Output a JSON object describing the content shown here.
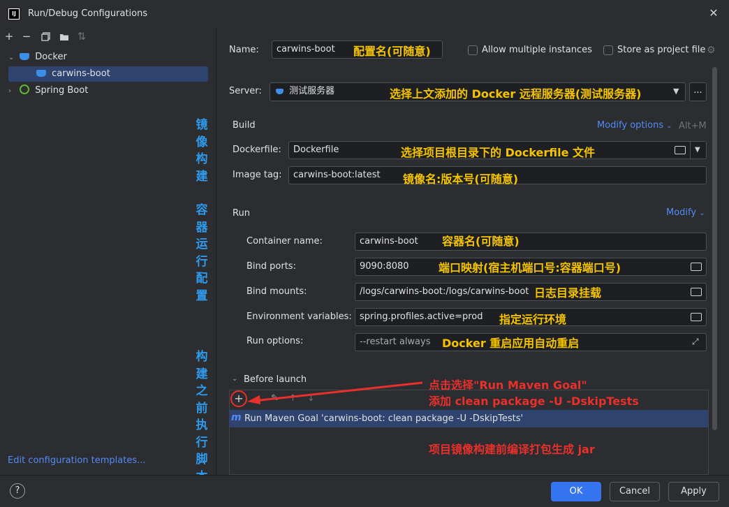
{
  "window": {
    "title": "Run/Debug Configurations",
    "app_icon_text": "IJ"
  },
  "sidebar": {
    "tree": [
      {
        "label": "Docker"
      },
      {
        "label": "carwins-boot"
      },
      {
        "label": "Spring Boot"
      }
    ],
    "vertical_notes": [
      "镜",
      "像",
      "构",
      "建",
      "容",
      "器",
      "运",
      "行",
      "配",
      "置",
      "构",
      "建",
      "之",
      "前",
      "执",
      "行",
      "脚",
      "本"
    ],
    "edit_templates": "Edit configuration templates..."
  },
  "form": {
    "name_label": "Name:",
    "name_value": "carwins-boot",
    "name_note": "配置名(可随意)",
    "allow_multiple": "Allow multiple instances",
    "store_project": "Store as project file",
    "server_label": "Server:",
    "server_value": "测试服务器",
    "server_note": "选择上文添加的 Docker 远程服务器(测试服务器)",
    "build": {
      "heading": "Build",
      "modify_options": "Modify options",
      "shortcut": "Alt+M",
      "dockerfile_label": "Dockerfile:",
      "dockerfile_value": "Dockerfile",
      "dockerfile_note": "选择项目根目录下的 Dockerfile 文件",
      "image_tag_label": "Image tag:",
      "image_tag_value": "carwins-boot:latest",
      "image_tag_note": "镜像名:版本号(可随意)"
    },
    "run": {
      "heading": "Run",
      "modify": "Modify",
      "container_label": "Container name:",
      "container_value": "carwins-boot",
      "container_note": "容器名(可随意)",
      "ports_label": "Bind ports:",
      "ports_value": "9090:8080",
      "ports_note": "端口映射(宿主机端口号:容器端口号)",
      "mounts_label": "Bind mounts:",
      "mounts_value": "/logs/carwins-boot:/logs/carwins-boot",
      "mounts_note": "日志目录挂载",
      "env_label": "Environment variables:",
      "env_value": "spring.profiles.active=prod",
      "env_note": "指定运行环境",
      "options_label": "Run options:",
      "options_value": "--restart always",
      "options_note": "Docker 重启应用自动重启"
    },
    "before_launch": {
      "heading": "Before launch",
      "note1": "点击选择\"Run Maven Goal\"",
      "note2": "添加 clean package -U -DskipTests",
      "task_icon": "m",
      "task": "Run Maven Goal 'carwins-boot: clean package -U -DskipTests'",
      "note3": "项目镜像构建前编译打包生成 jar"
    }
  },
  "footer": {
    "help": "?",
    "ok": "OK",
    "cancel": "Cancel",
    "apply": "Apply"
  },
  "colors": {
    "accent": "#3574f0",
    "annotation": "#f5c400",
    "annotation_red": "#e8302c",
    "vertical_note": "#2f9aeb",
    "selection": "#2e436e"
  }
}
